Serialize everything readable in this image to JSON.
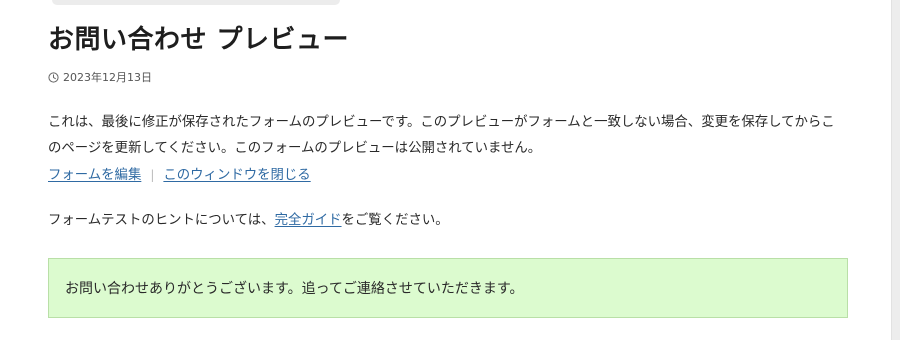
{
  "page": {
    "title": "お問い合わせ プレビュー",
    "date": "2023年12月13日",
    "intro_text": "これは、最後に修正が保存されたフォームのプレビューです。このプレビューがフォームと一致しない場合、変更を保存してからこのページを更新してください。このフォームのプレビューは公開されていません。",
    "links": {
      "edit_form": "フォームを編集",
      "separator": "|",
      "close_window": "このウィンドウを閉じる"
    },
    "hint": {
      "before": "フォームテストのヒントについては、",
      "link": "完全ガイド",
      "after": "をご覧ください。"
    },
    "confirmation_message": "お問い合わせありがとうございます。追ってご連絡させていただきます。"
  },
  "icons": {
    "date": "clock-icon"
  },
  "colors": {
    "link": "#2f6aa3",
    "notice_background": "#dcfbcf",
    "notice_border": "#b9dfa7",
    "title": "#1e1e1e"
  }
}
